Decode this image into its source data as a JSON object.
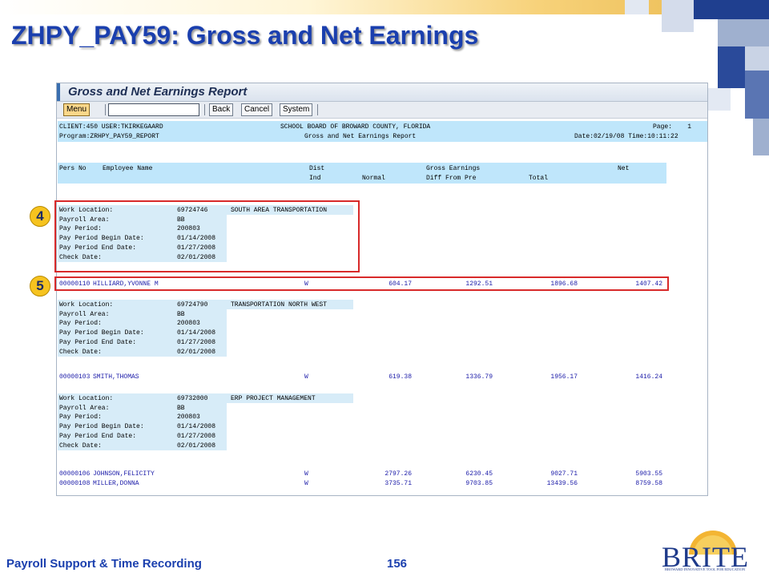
{
  "slide": {
    "title": "ZHPY_PAY59: Gross and Net Earnings",
    "footer_left": "Payroll Support & Time Recording",
    "page_number": "156"
  },
  "logo": {
    "text": "BRITE",
    "tagline": "BROWARD INNOVATIVE TOOL FOR EDUCATION"
  },
  "colors": {
    "title": "#1a3fae",
    "sap_header_bg": "#bfe6fb",
    "callout_border": "#d82a2a",
    "badge": "#f6c31f",
    "report_text_blue": "#1a1aa8"
  },
  "sap_window": {
    "title": "Gross and Net Earnings Report",
    "toolbar": {
      "menu": "Menu",
      "back": "Back",
      "cancel": "Cancel",
      "system": "System",
      "command_value": ""
    }
  },
  "report": {
    "header": {
      "client": "CLIENT:450 USER:TKIRKEGAARD",
      "org": "SCHOOL BOARD OF BROWARD COUNTY, FLORIDA",
      "page": "Page:    1",
      "program": "Program:ZRHPY_PAY59_REPORT",
      "report_name": "Gross and Net Earnings Report",
      "datetime": "Date:02/19/08 Time:10:11:22"
    },
    "columns": {
      "pers_no": "Pers No",
      "name": "Employee Name",
      "dist": "Dist",
      "ind": "Ind",
      "normal": "Normal",
      "gross": "Gross Earnings",
      "diff": "Diff From Pre",
      "total": "Total",
      "net": "Net"
    },
    "labels": {
      "work_location": "Work Location:",
      "payroll_area": "Payroll Area:",
      "pay_period": "Pay Period:",
      "begin": "Pay Period Begin Date:",
      "end": "Pay Period End Date:",
      "check": "Check Date:"
    },
    "groups": [
      {
        "work_location": "69724746",
        "location_name": "SOUTH AREA TRANSPORTATION",
        "payroll_area": "BB",
        "pay_period": "200803",
        "begin_date": "01/14/2008",
        "end_date": "01/27/2008",
        "check_date": "02/01/2008",
        "rows": [
          {
            "pers_no": "00000110",
            "name": "HILLIARD,YVONNE M",
            "dist": "W",
            "normal": "604.17",
            "diff": "1292.51",
            "total": "1896.68",
            "net": "1407.42"
          }
        ]
      },
      {
        "work_location": "69724790",
        "location_name": "TRANSPORTATION NORTH WEST",
        "payroll_area": "BB",
        "pay_period": "200803",
        "begin_date": "01/14/2008",
        "end_date": "01/27/2008",
        "check_date": "02/01/2008",
        "rows": [
          {
            "pers_no": "00000103",
            "name": "SMITH,THOMAS",
            "dist": "W",
            "normal": "619.38",
            "diff": "1336.79",
            "total": "1956.17",
            "net": "1416.24"
          }
        ]
      },
      {
        "work_location": "69732000",
        "location_name": "ERP PROJECT MANAGEMENT",
        "payroll_area": "BB",
        "pay_period": "200803",
        "begin_date": "01/14/2008",
        "end_date": "01/27/2008",
        "check_date": "02/01/2008",
        "rows": [
          {
            "pers_no": "00000106",
            "name": "JOHNSON,FELICITY",
            "dist": "W",
            "normal": "2797.26",
            "diff": "6230.45",
            "total": "9027.71",
            "net": "5903.55"
          },
          {
            "pers_no": "00000108",
            "name": "MILLER,DONNA",
            "dist": "W",
            "normal": "3735.71",
            "diff": "9703.85",
            "total": "13439.56",
            "net": "8759.58"
          }
        ]
      }
    ]
  },
  "callouts": {
    "group_badge": "4",
    "row_badge": "5"
  }
}
